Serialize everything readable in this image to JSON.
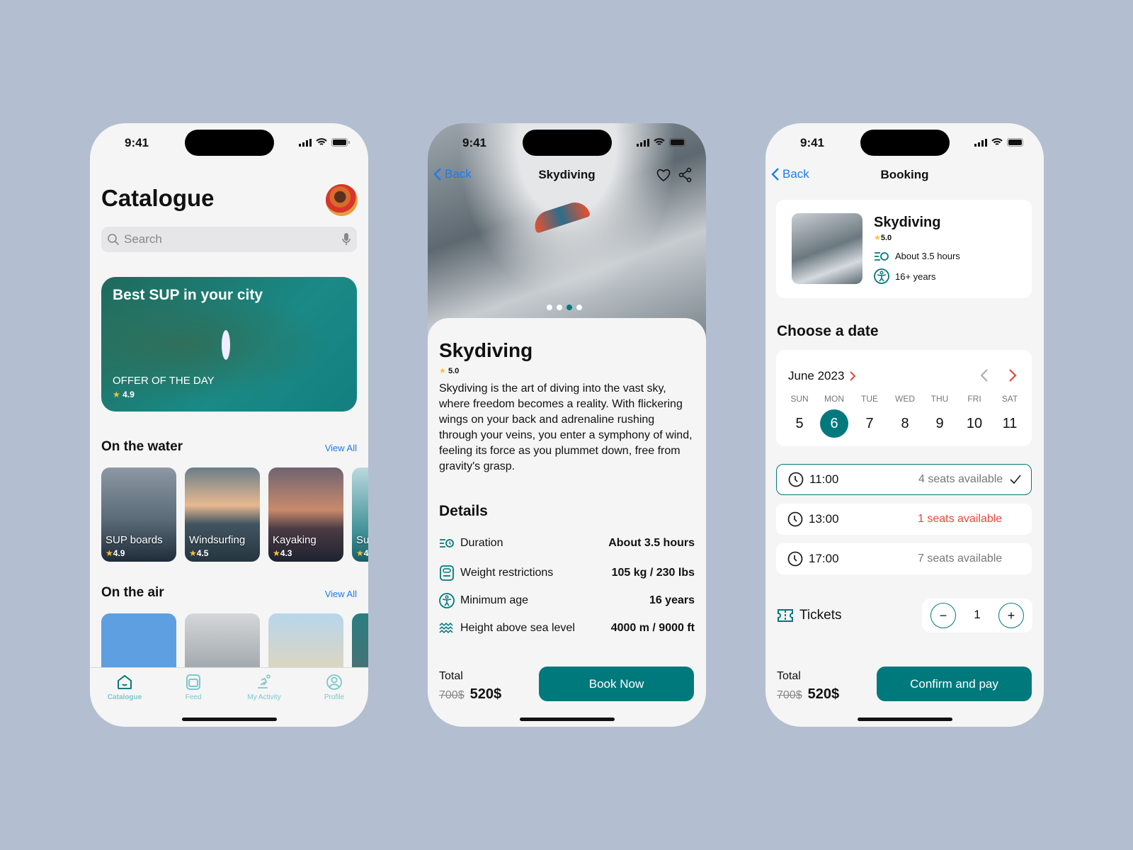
{
  "status": {
    "time": "9:41"
  },
  "colors": {
    "accent": "#00797d",
    "link": "#1a7cf0",
    "warning": "#e5483b",
    "background": "#b3bfd0"
  },
  "catalogue": {
    "title": "Catalogue",
    "search_placeholder": "Search",
    "banner": {
      "title": "Best SUP in your city",
      "subtitle": "OFFER OF THE DAY",
      "rating": "4.9"
    },
    "water": {
      "title": "On the water",
      "view_all": "View All",
      "items": [
        {
          "label": "SUP boards",
          "rating": "4.9"
        },
        {
          "label": "Windsurfing",
          "rating": "4.5"
        },
        {
          "label": "Kayaking",
          "rating": "4.3"
        },
        {
          "label": "Su",
          "rating": "4"
        }
      ]
    },
    "air": {
      "title": "On the air",
      "view_all": "View All"
    },
    "tabs": [
      {
        "label": "Catalogue",
        "icon": "home-icon",
        "active": true
      },
      {
        "label": "Feed",
        "icon": "feed-icon"
      },
      {
        "label": "My Activity",
        "icon": "activity-icon"
      },
      {
        "label": "Profile",
        "icon": "profile-icon"
      }
    ]
  },
  "detail": {
    "back": "Back",
    "nav_title": "Skydiving",
    "title": "Skydiving",
    "rating": "5.0",
    "description": "Skydiving is the art of diving into the vast sky, where freedom becomes a reality. With flickering wings on your back and adrenaline rushing through your veins, you enter a symphony of wind, feeling its force as you plummet down, free from gravity's grasp.",
    "carousel": {
      "count": 4,
      "active": 3
    },
    "details_title": "Details",
    "details": [
      {
        "label": "Duration",
        "value": "About 3.5 hours",
        "icon": "duration-icon"
      },
      {
        "label": "Weight restrictions",
        "value": "105 kg / 230 lbs",
        "icon": "scale-icon"
      },
      {
        "label": "Minimum age",
        "value": "16 years",
        "icon": "person-icon"
      },
      {
        "label": "Height above sea level",
        "value": "4000 m / 9000 ft",
        "icon": "waves-icon"
      }
    ],
    "total_label": "Total",
    "old_price": "700$",
    "price": "520$",
    "cta": "Book Now"
  },
  "booking": {
    "back": "Back",
    "nav_title": "Booking",
    "activity": {
      "title": "Skydiving",
      "rating": "5.0",
      "duration": "About 3.5 hours",
      "age": "16+ years"
    },
    "choose_date": "Choose a date",
    "month": "June 2023",
    "weekdays": [
      "SUN",
      "MON",
      "TUE",
      "WED",
      "THU",
      "FRI",
      "SAT"
    ],
    "days": [
      "5",
      "6",
      "7",
      "8",
      "9",
      "10",
      "11"
    ],
    "selected_day": "6",
    "slots": [
      {
        "time": "11:00",
        "seats": "4 seats available",
        "selected": true
      },
      {
        "time": "13:00",
        "seats": "1 seats available",
        "low": true
      },
      {
        "time": "17:00",
        "seats": "7 seats available"
      }
    ],
    "tickets_label": "Tickets",
    "tickets": "1",
    "total_label": "Total",
    "old_price": "700$",
    "price": "520$",
    "cta": "Confirm and pay"
  }
}
